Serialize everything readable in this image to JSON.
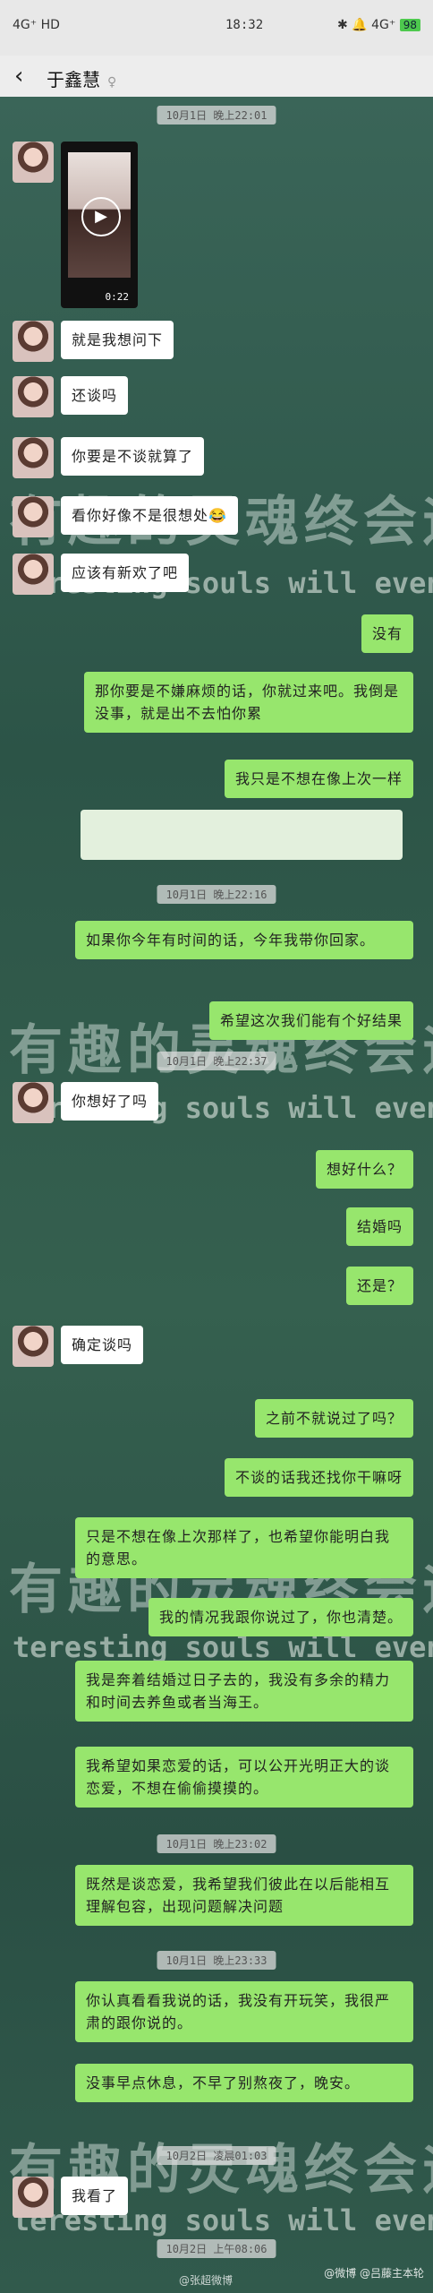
{
  "status_bar": {
    "left": "4G⁺ HD",
    "time": "18:32",
    "right": "✱ 🔔 4G⁺",
    "battery": "98"
  },
  "header": {
    "back": "‹",
    "contact_name": "于鑫慧",
    "gender_mark": "♀"
  },
  "watermarks": {
    "big_1": "有趣的灵魂终会遇",
    "eng_1": "teresting souls will eventually m",
    "big_2": "有趣的灵魂终会遇",
    "eng_2": "teresting souls will eventually",
    "big_3": "有趣的灵魂终会遇",
    "eng_3": "teresting souls will eventually",
    "big_4": "有趣的灵魂终会遇",
    "eng_4": "teresting souls will eventually"
  },
  "timestamps": {
    "t1": "10月1日 晚上22:01",
    "t2": "10月1日 晚上22:16",
    "t3": "10月1日 晚上22:37",
    "t4": "10月1日 晚上23:02",
    "t5": "10月1日 晚上23:33",
    "t6": "10月2日 凌晨01:03",
    "t7": "10月2日 上午08:06"
  },
  "video_duration": "0:22",
  "messages": {
    "m1": "就是我想问下",
    "m2": "还谈吗",
    "m3": "你要是不谈就算了",
    "m4": "看你好像不是很想处😂",
    "m5": "应该有新欢了吧",
    "m6": "没有",
    "m7": "那你要是不嫌麻烦的话，你就过来吧。我倒是没事，就是出不去怕你累",
    "m8": "我只是不想在像上次一样",
    "m9": "如果你今年有时间的话，今年我带你回家。",
    "m10": "希望这次我们能有个好结果",
    "m11": "你想好了吗",
    "m12": "想好什么？",
    "m13": "结婚吗",
    "m14": "还是？",
    "m15": "确定谈吗",
    "m16": "之前不就说过了吗？",
    "m17": "不谈的话我还找你干嘛呀",
    "m18": "只是不想在像上次那样了，也希望你能明白我的意思。",
    "m19": "我的情况我跟你说过了，你也清楚。",
    "m20": "我是奔着结婚过日子去的，我没有多余的精力和时间去养鱼或者当海王。",
    "m21": "我希望如果恋爱的话，可以公开光明正大的谈恋爱，不想在偷偷摸摸的。",
    "m22": "既然是谈恋爱，我希望我们彼此在以后能相互理解包容，出现问题解决问题",
    "m23": "你认真看看我说的话，我没有开玩笑，我很严肃的跟你说的。",
    "m24": "没事早点休息，不早了别熬夜了，晚安。",
    "m25": "我看了"
  },
  "credits": {
    "bottom_right": "@微博 @吕藤主本轮",
    "bottom_mid": "@张超微博"
  },
  "colors": {
    "incoming_bubble": "#ffffff",
    "outgoing_bubble": "#97e66d",
    "background": "#2f5a4f"
  }
}
